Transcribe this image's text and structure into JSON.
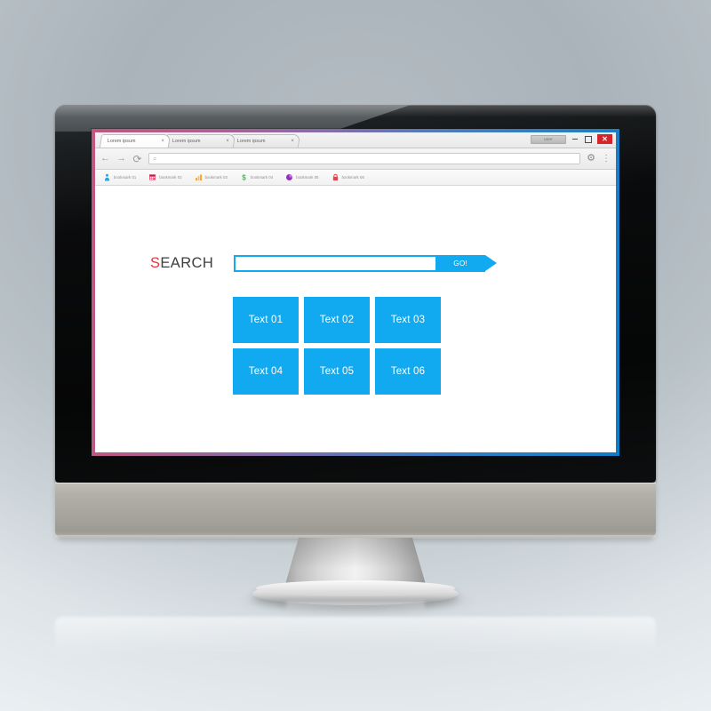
{
  "browser": {
    "tabs": [
      {
        "label": "Lorem ipsum",
        "close": "×"
      },
      {
        "label": "Lorem ipsum",
        "close": "×"
      },
      {
        "label": "Lorem ipsum",
        "close": "×"
      }
    ],
    "window_controls": {
      "user_label": "user",
      "minimize_name": "minimize-button",
      "maximize_name": "maximize-button",
      "close_label": "✕"
    },
    "toolbar": {
      "back_icon": "←",
      "forward_icon": "→",
      "reload_icon": "⟳",
      "search_icon": "⌕",
      "address_value": "",
      "address_placeholder": "",
      "settings_icon": "⚙",
      "menu_icon": "⋮"
    },
    "bookmarks": [
      {
        "label": "bookmark 01",
        "icon": "person-icon",
        "color": "#29a3dc"
      },
      {
        "label": "bookmark 02",
        "icon": "calendar-icon",
        "color": "#e8456f"
      },
      {
        "label": "bookmark 03",
        "icon": "bar-chart-icon",
        "color": "#f3a63a"
      },
      {
        "label": "bookmark 04",
        "icon": "dollar-icon",
        "color": "#3bbf4a"
      },
      {
        "label": "bookmark 05",
        "icon": "pie-chart-icon",
        "color": "#8e30b8"
      },
      {
        "label": "bookmark 06",
        "icon": "padlock-icon",
        "color": "#ef4048"
      }
    ]
  },
  "page": {
    "search": {
      "label_first": "S",
      "label_rest": "EARCH",
      "input_value": "",
      "input_placeholder": "",
      "go_label": "GO!"
    },
    "tiles": [
      {
        "label": "Text 01"
      },
      {
        "label": "Text 02"
      },
      {
        "label": "Text 03"
      },
      {
        "label": "Text 04"
      },
      {
        "label": "Text 05"
      },
      {
        "label": "Text 06"
      }
    ]
  },
  "theme": {
    "accent_blue": "#11a9ef",
    "accent_red": "#e8343c",
    "close_red": "#d7232a",
    "frame_gradient_start": "#c2567f",
    "frame_gradient_end": "#0f7cc6"
  }
}
